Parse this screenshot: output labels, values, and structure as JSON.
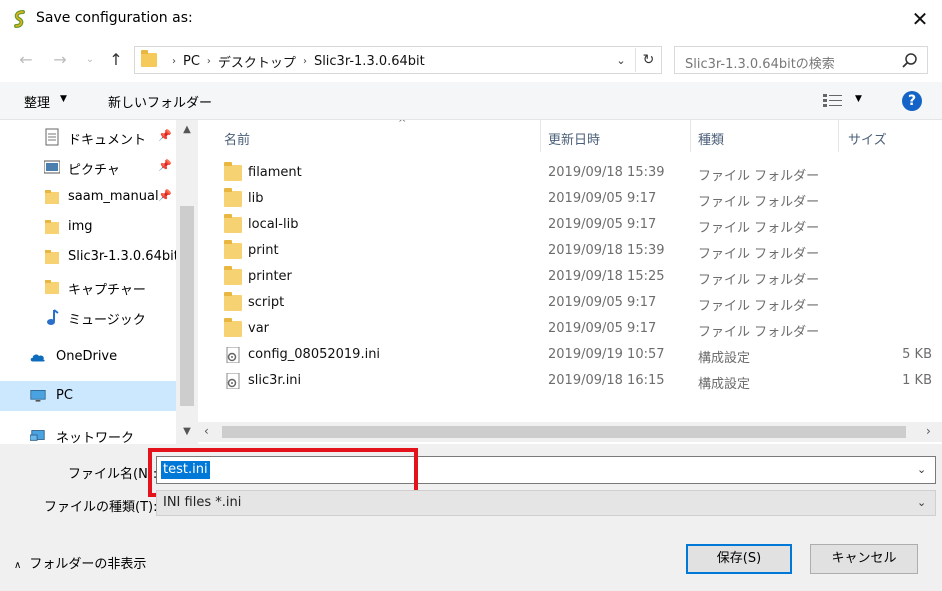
{
  "window": {
    "title": "Save configuration as:",
    "close_glyph": "✕"
  },
  "nav": {
    "back": "←",
    "forward": "→",
    "recent": "⌄",
    "up": "↑",
    "breadcrumbs": [
      "PC",
      "デスクトップ",
      "Slic3r-1.3.0.64bit"
    ],
    "separator": "›",
    "search_placeholder": "Slic3r-1.3.0.64bitの検索"
  },
  "toolbar": {
    "organize": "整理",
    "new_folder": "新しいフォルダー",
    "help": "?"
  },
  "sidebar": {
    "items": [
      {
        "label": "ドキュメント",
        "icon": "documents-icon",
        "pinned": true
      },
      {
        "label": "ピクチャ",
        "icon": "pictures-icon",
        "pinned": true
      },
      {
        "label": "saam_manual",
        "icon": "folder-icon",
        "pinned": true
      },
      {
        "label": "img",
        "icon": "folder-icon",
        "pinned": false
      },
      {
        "label": "Slic3r-1.3.0.64bit",
        "icon": "folder-icon",
        "pinned": false
      },
      {
        "label": "キャプチャー",
        "icon": "folder-icon",
        "pinned": false
      },
      {
        "label": "ミュージック",
        "icon": "music-icon",
        "pinned": false
      },
      {
        "label": "OneDrive",
        "icon": "onedrive-icon",
        "pinned": false
      },
      {
        "label": "PC",
        "icon": "pc-icon",
        "pinned": false,
        "selected": true
      },
      {
        "label": "ネットワーク",
        "icon": "network-icon",
        "pinned": false
      }
    ],
    "pin_glyph": "📌"
  },
  "files": {
    "columns": {
      "name": "名前",
      "date": "更新日時",
      "type": "種類",
      "size": "サイズ"
    },
    "rows": [
      {
        "name": "filament",
        "date": "2019/09/18 15:39",
        "type": "ファイル フォルダー",
        "size": "",
        "kind": "folder"
      },
      {
        "name": "lib",
        "date": "2019/09/05 9:17",
        "type": "ファイル フォルダー",
        "size": "",
        "kind": "folder"
      },
      {
        "name": "local-lib",
        "date": "2019/09/05 9:17",
        "type": "ファイル フォルダー",
        "size": "",
        "kind": "folder"
      },
      {
        "name": "print",
        "date": "2019/09/18 15:39",
        "type": "ファイル フォルダー",
        "size": "",
        "kind": "folder"
      },
      {
        "name": "printer",
        "date": "2019/09/18 15:25",
        "type": "ファイル フォルダー",
        "size": "",
        "kind": "folder"
      },
      {
        "name": "script",
        "date": "2019/09/05 9:17",
        "type": "ファイル フォルダー",
        "size": "",
        "kind": "folder"
      },
      {
        "name": "var",
        "date": "2019/09/05 9:17",
        "type": "ファイル フォルダー",
        "size": "",
        "kind": "folder"
      },
      {
        "name": "config_08052019.ini",
        "date": "2019/09/19 10:57",
        "type": "構成設定",
        "size": "5 KB",
        "kind": "ini"
      },
      {
        "name": "slic3r.ini",
        "date": "2019/09/18 16:15",
        "type": "構成設定",
        "size": "1 KB",
        "kind": "ini"
      }
    ]
  },
  "bottom": {
    "filename_label": "ファイル名(N):",
    "filename_value": "test.ini",
    "filetype_label": "ファイルの種類(T):",
    "filetype_value": "INI files *.ini",
    "hide_folders": "フォルダーの非表示",
    "save_button": "保存(S)",
    "cancel_button": "キャンセル"
  },
  "colors": {
    "accent": "#0078d7",
    "highlight_box": "#e3121b",
    "folder": "#f7d272",
    "selected_nav": "#cce8ff"
  }
}
